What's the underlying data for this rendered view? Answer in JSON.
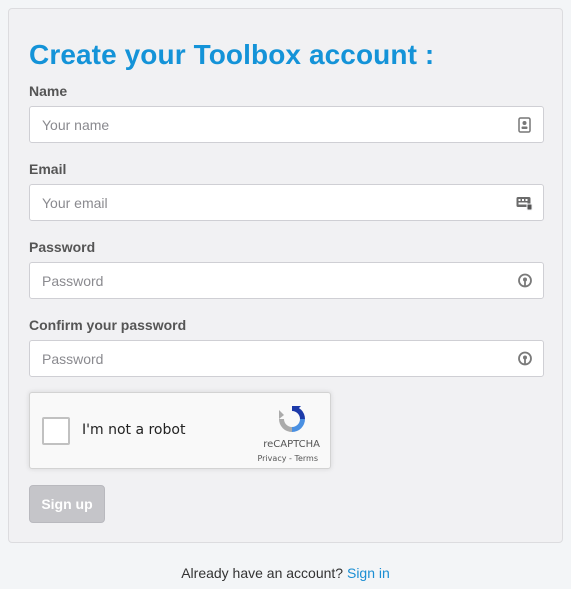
{
  "form": {
    "title": "Create your Toolbox account :",
    "fields": [
      {
        "label": "Name",
        "placeholder": "Your name",
        "value": "",
        "icon": "contact-card-icon"
      },
      {
        "label": "Email",
        "placeholder": "Your email",
        "value": "",
        "icon": "email-keyboard-icon"
      },
      {
        "label": "Password",
        "placeholder": "Password",
        "value": "",
        "icon": "password-key-icon"
      },
      {
        "label": "Confirm your password",
        "placeholder": "Password",
        "value": "",
        "icon": "password-key-icon"
      }
    ],
    "recaptcha": {
      "checkbox_label": "I'm not a robot",
      "brand": "reCAPTCHA",
      "privacy": "Privacy",
      "separator": " - ",
      "terms": "Terms"
    },
    "submit_label": "Sign up"
  },
  "footer": {
    "prompt": "Already have an account?",
    "link": "Sign in"
  },
  "colors": {
    "accent": "#1493d8",
    "link": "#1a8ed3",
    "button_disabled": "#c5c5c9"
  }
}
